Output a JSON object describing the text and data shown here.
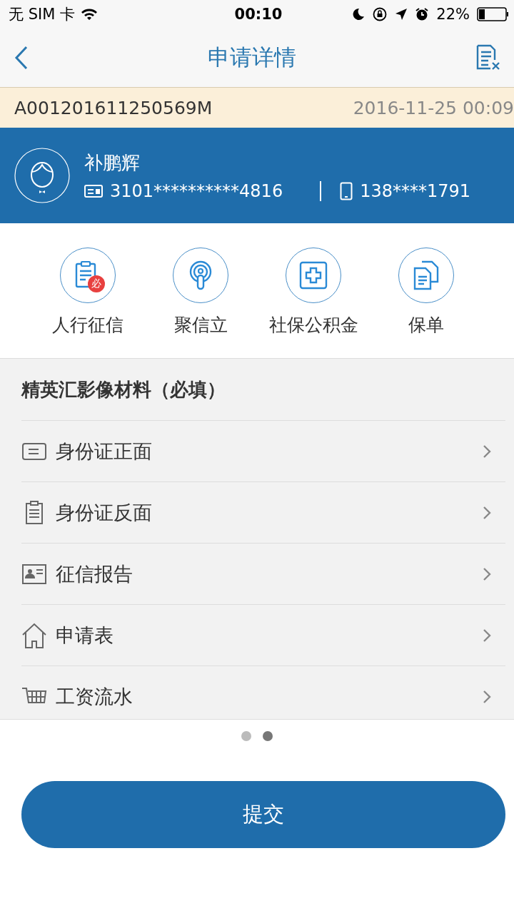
{
  "status_bar": {
    "carrier": "无 SIM 卡",
    "time": "00:10",
    "battery": "22%"
  },
  "nav": {
    "title": "申请详情"
  },
  "order": {
    "number": "A001201611250569M",
    "date": "2016-11-25 00:09"
  },
  "applicant": {
    "name": "补鹏辉",
    "id_number": "3101**********4816",
    "phone": "138****1791"
  },
  "quick_actions": [
    {
      "label": "人行征信",
      "badge": "必"
    },
    {
      "label": "聚信立"
    },
    {
      "label": "社保公积金"
    },
    {
      "label": "保单"
    }
  ],
  "materials": {
    "title": "精英汇影像材料（必填）",
    "items": [
      {
        "label": "身份证正面"
      },
      {
        "label": "身份证反面"
      },
      {
        "label": "征信报告"
      },
      {
        "label": "申请表"
      },
      {
        "label": "工资流水"
      }
    ]
  },
  "pager": [
    {
      "selected": false
    },
    {
      "selected": true
    }
  ],
  "submit": {
    "label": "提交"
  }
}
